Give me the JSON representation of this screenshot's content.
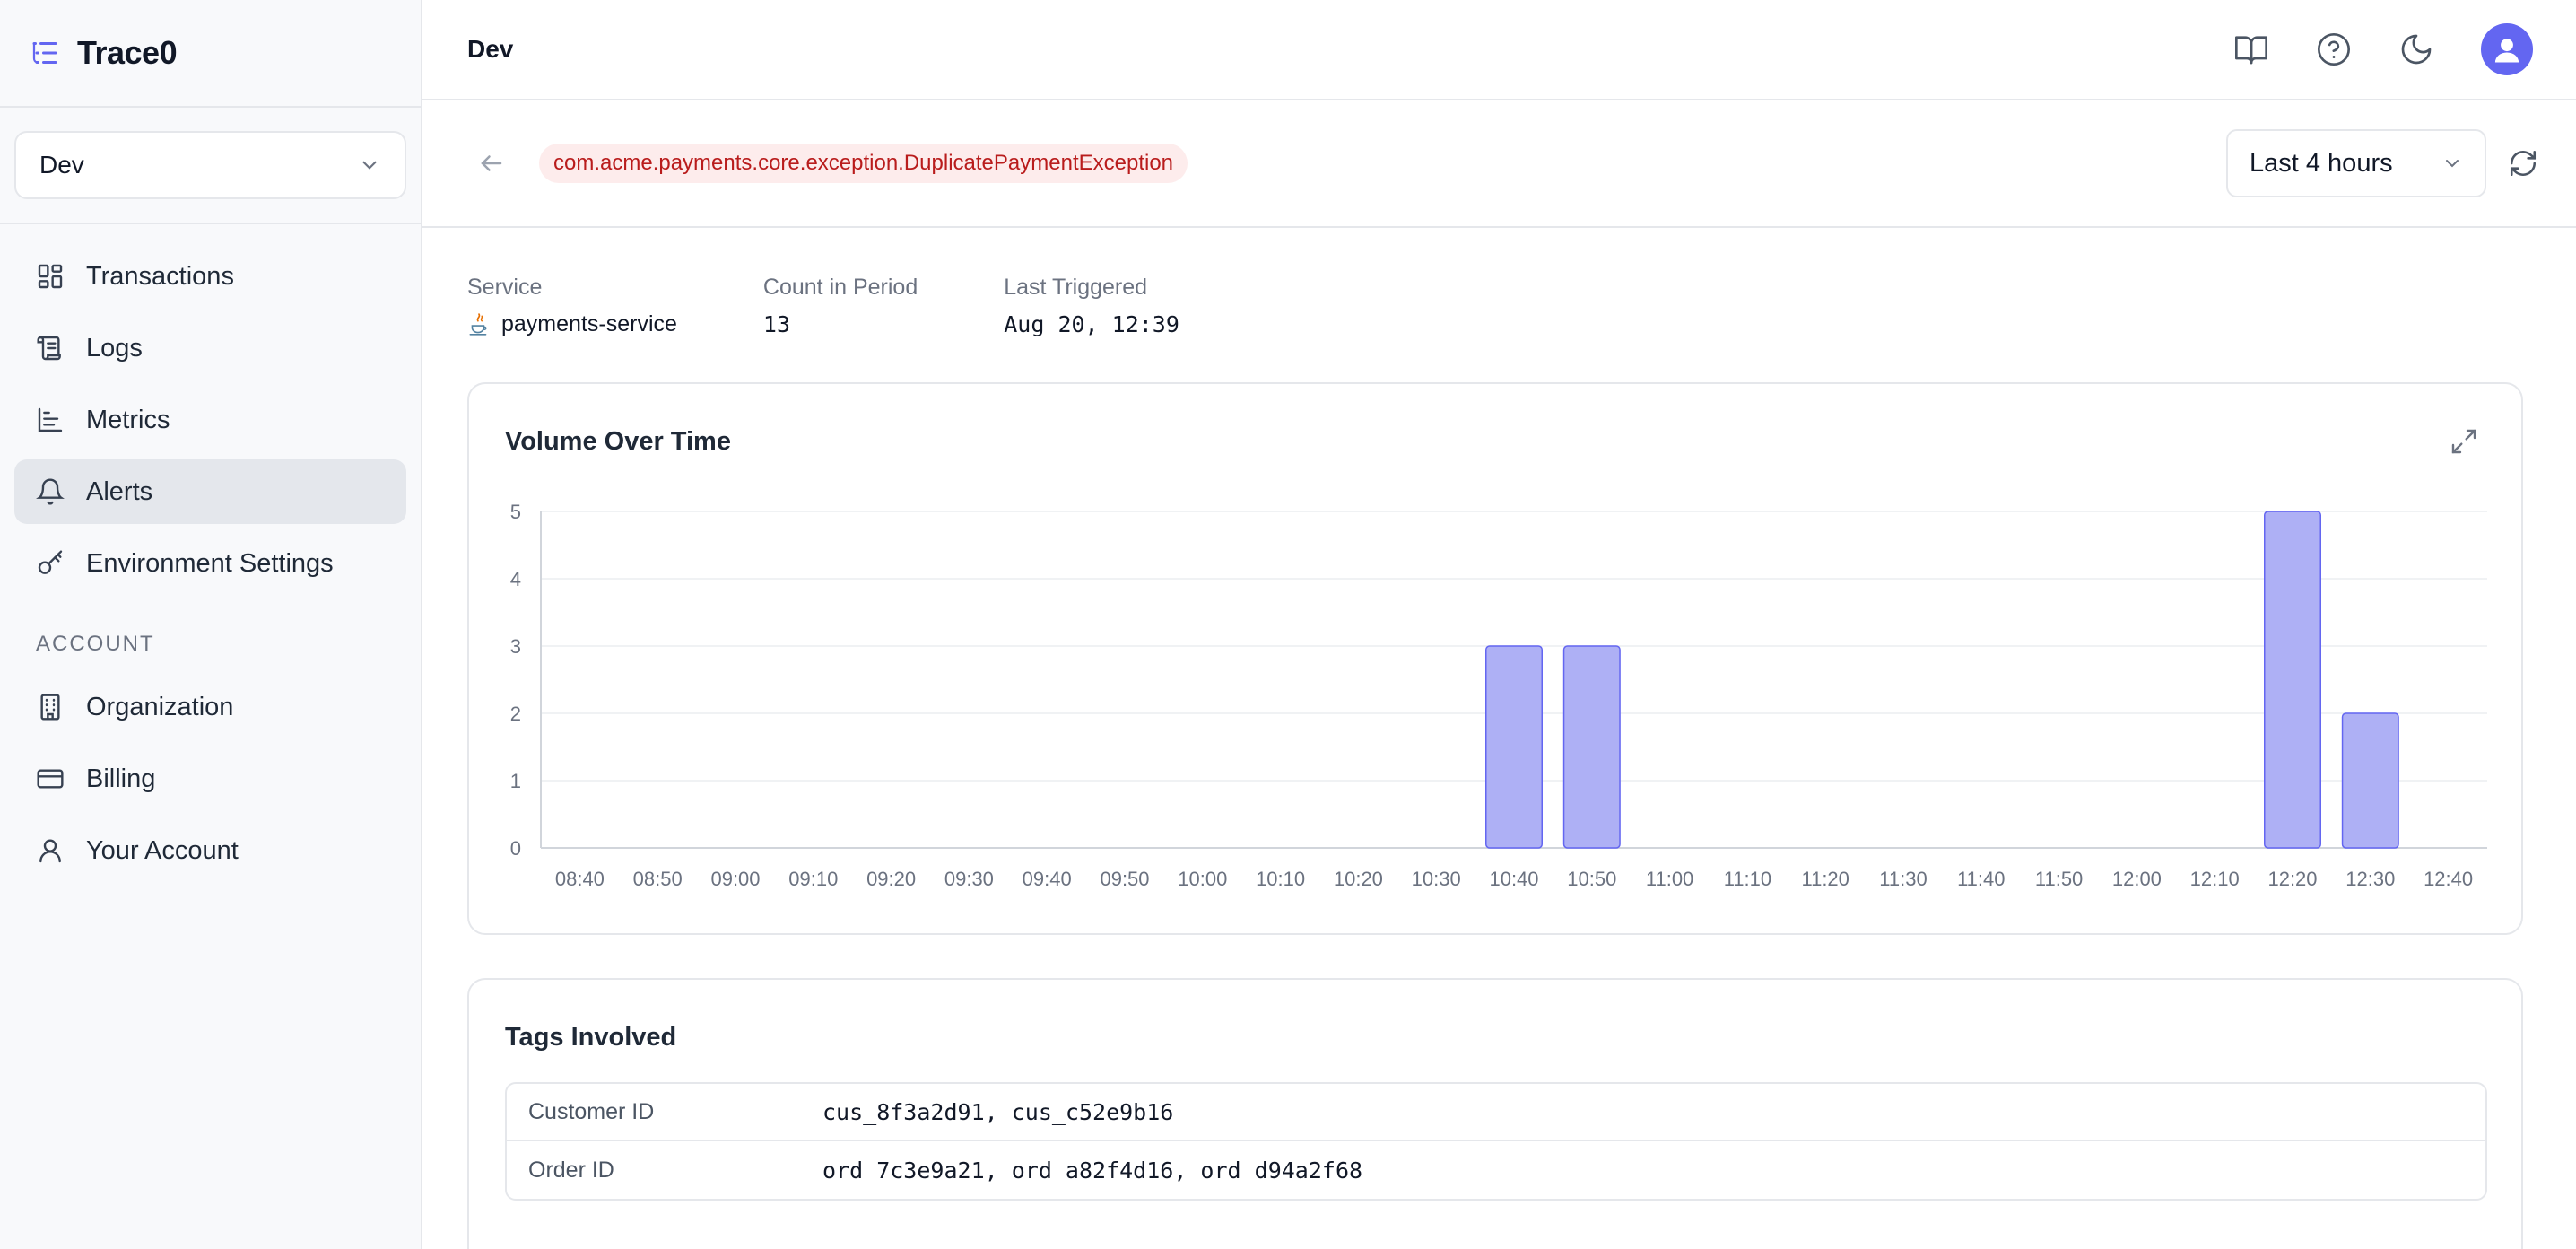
{
  "app": {
    "name": "Trace0"
  },
  "environment": {
    "selected": "Dev"
  },
  "sidebar": {
    "items": [
      {
        "label": "Transactions",
        "icon": "grid-icon"
      },
      {
        "label": "Logs",
        "icon": "scroll-icon"
      },
      {
        "label": "Metrics",
        "icon": "bar-chart-icon"
      },
      {
        "label": "Alerts",
        "icon": "bell-icon",
        "active": true
      },
      {
        "label": "Environment Settings",
        "icon": "key-icon"
      }
    ],
    "account_label": "ACCOUNT",
    "account_items": [
      {
        "label": "Organization",
        "icon": "building-icon"
      },
      {
        "label": "Billing",
        "icon": "credit-card-icon"
      },
      {
        "label": "Your Account",
        "icon": "user-icon"
      }
    ]
  },
  "topbar": {
    "title": "Dev",
    "icons": [
      "book-icon",
      "help-icon",
      "moon-icon",
      "avatar"
    ]
  },
  "header": {
    "exception": "com.acme.payments.core.exception.DuplicatePaymentException",
    "time_range": "Last 4 hours"
  },
  "meta": {
    "service_label": "Service",
    "service_value": "payments-service",
    "count_label": "Count in Period",
    "count_value": "13",
    "last_label": "Last Triggered",
    "last_value": "Aug 20, 12:39"
  },
  "chart_card": {
    "title": "Volume Over Time"
  },
  "chart_data": {
    "type": "bar",
    "title": "Volume Over Time",
    "categories": [
      "08:40",
      "08:50",
      "09:00",
      "09:10",
      "09:20",
      "09:30",
      "09:40",
      "09:50",
      "10:00",
      "10:10",
      "10:20",
      "10:30",
      "10:40",
      "10:50",
      "11:00",
      "11:10",
      "11:20",
      "11:30",
      "11:40",
      "11:50",
      "12:00",
      "12:10",
      "12:20",
      "12:30",
      "12:40"
    ],
    "values": [
      0,
      0,
      0,
      0,
      0,
      0,
      0,
      0,
      0,
      0,
      0,
      0,
      3,
      3,
      0,
      0,
      0,
      0,
      0,
      0,
      0,
      0,
      5,
      2,
      0
    ],
    "ylim": [
      0,
      5
    ],
    "yticks": [
      0,
      1,
      2,
      3,
      4,
      5
    ],
    "grid": true,
    "color": "#aeb0f5",
    "edge_color": "#6366f1"
  },
  "tags": {
    "title": "Tags Involved",
    "rows": [
      {
        "key": "Customer ID",
        "value": "cus_8f3a2d91, cus_c52e9b16"
      },
      {
        "key": "Order ID",
        "value": "ord_7c3e9a21, ord_a82f4d16, ord_d94a2f68"
      }
    ]
  }
}
